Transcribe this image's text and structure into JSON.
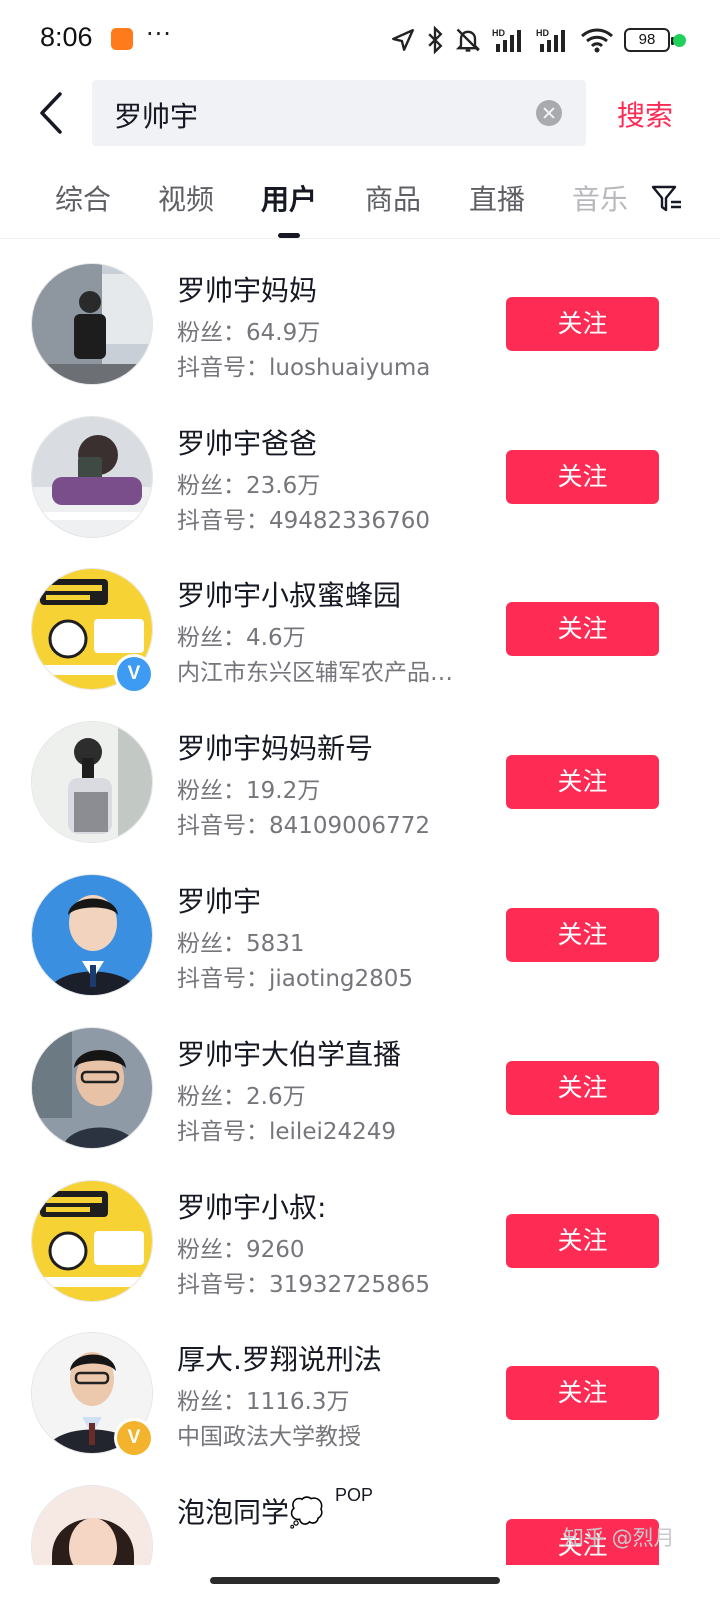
{
  "status_bar": {
    "time": "8:06",
    "dots": "···",
    "battery": "98",
    "icons": [
      "location-arrow-icon",
      "bluetooth-icon",
      "bell-muted-icon",
      "hd-signal-icon",
      "hd-signal-icon",
      "wifi-icon",
      "battery-icon"
    ]
  },
  "search": {
    "query": "罗帅宇",
    "button_label": "搜索"
  },
  "tabs": [
    {
      "label": "综合"
    },
    {
      "label": "视频"
    },
    {
      "label": "用户"
    },
    {
      "label": "商品"
    },
    {
      "label": "直播"
    },
    {
      "label": "音乐"
    }
  ],
  "active_tab": "用户",
  "colors": {
    "accent": "#fe2c55",
    "text_primary": "#161823",
    "text_secondary": "#75767b"
  },
  "users": [
    {
      "name": "罗帅宇妈妈",
      "fans": "粉丝：64.9万",
      "subline": "抖音号：luoshuaiyuma",
      "follow_label": "关注"
    },
    {
      "name": "罗帅宇爸爸",
      "fans": "粉丝：23.6万",
      "subline": "抖音号：49482336760",
      "follow_label": "关注"
    },
    {
      "name": "罗帅宇小叔蜜蜂园",
      "fans": "粉丝：4.6万",
      "subline": "内江市东兴区辅军农产品…",
      "follow_label": "关注",
      "badge": "V",
      "badge_color": "blue"
    },
    {
      "name": "罗帅宇妈妈新号",
      "fans": "粉丝：19.2万",
      "subline": "抖音号：84109006772",
      "follow_label": "关注"
    },
    {
      "name": "罗帅宇",
      "fans": "粉丝：5831",
      "subline": "抖音号：jiaoting2805",
      "follow_label": "关注"
    },
    {
      "name": "罗帅宇大伯学直播",
      "fans": "粉丝：2.6万",
      "subline": "抖音号：leilei24249",
      "follow_label": "关注"
    },
    {
      "name": "罗帅宇小叔:",
      "fans": "粉丝：9260",
      "subline": "抖音号：31932725865",
      "follow_label": "关注"
    },
    {
      "name": "厚大.罗翔说刑法",
      "fans": "粉丝：1116.3万",
      "subline": "中国政法大学教授",
      "follow_label": "关注",
      "badge": "V",
      "badge_color": "gold"
    },
    {
      "name": "泡泡同学💭",
      "pop": "POP",
      "follow_label": "关注"
    }
  ],
  "watermark": "知乎 @烈月"
}
